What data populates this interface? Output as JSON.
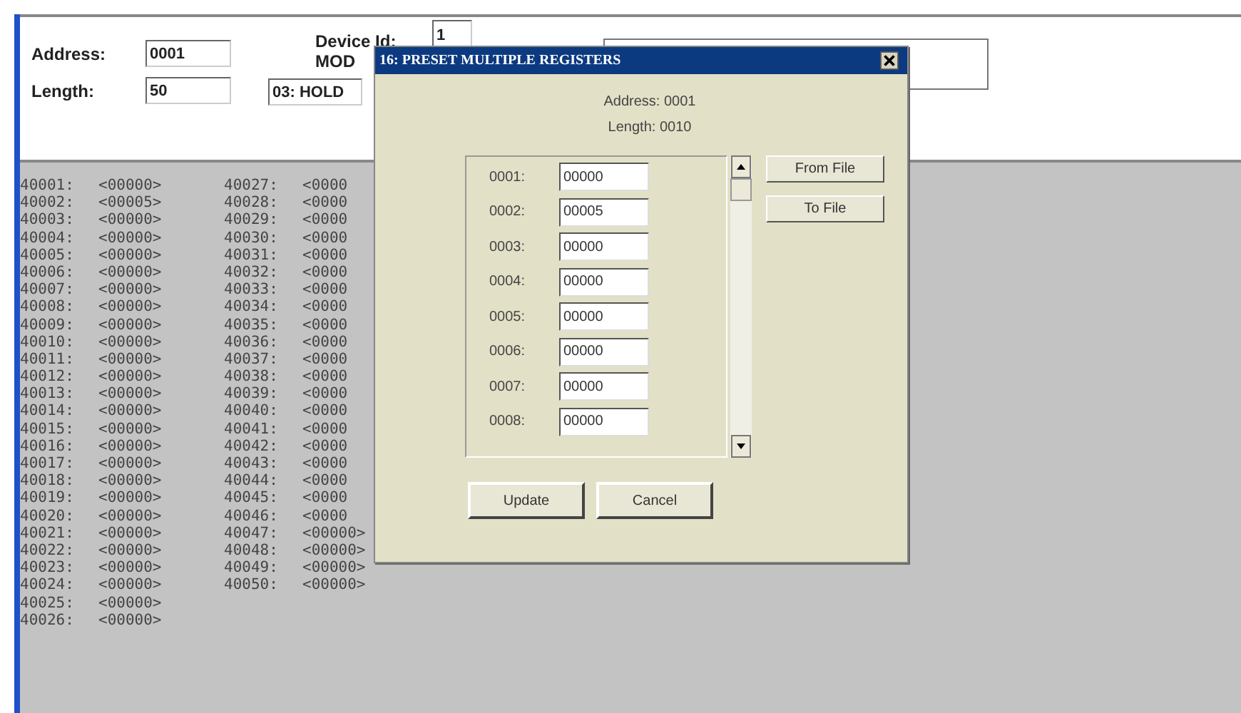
{
  "form": {
    "address_label": "Address:",
    "address_value": "0001",
    "length_label": "Length:",
    "length_value": "50",
    "device_id_label": "Device Id:",
    "device_id_value": "1",
    "mode_label": "MOD",
    "function_value": "03: HOLD"
  },
  "registers": {
    "column_1": [
      {
        "address": "40001:",
        "value": "<00000>"
      },
      {
        "address": "40002:",
        "value": "<00005>"
      },
      {
        "address": "40003:",
        "value": "<00000>"
      },
      {
        "address": "40004:",
        "value": "<00000>"
      },
      {
        "address": "40005:",
        "value": "<00000>"
      },
      {
        "address": "40006:",
        "value": "<00000>"
      },
      {
        "address": "40007:",
        "value": "<00000>"
      },
      {
        "address": "40008:",
        "value": "<00000>"
      },
      {
        "address": "40009:",
        "value": "<00000>"
      },
      {
        "address": "40010:",
        "value": "<00000>"
      },
      {
        "address": "40011:",
        "value": "<00000>"
      },
      {
        "address": "40012:",
        "value": "<00000>"
      },
      {
        "address": "40013:",
        "value": "<00000>"
      },
      {
        "address": "40014:",
        "value": "<00000>"
      },
      {
        "address": "40015:",
        "value": "<00000>"
      },
      {
        "address": "40016:",
        "value": "<00000>"
      },
      {
        "address": "40017:",
        "value": "<00000>"
      },
      {
        "address": "40018:",
        "value": "<00000>"
      },
      {
        "address": "40019:",
        "value": "<00000>"
      },
      {
        "address": "40020:",
        "value": "<00000>"
      },
      {
        "address": "40021:",
        "value": "<00000>"
      },
      {
        "address": "40022:",
        "value": "<00000>"
      },
      {
        "address": "40023:",
        "value": "<00000>"
      },
      {
        "address": "40024:",
        "value": "<00000>"
      },
      {
        "address": "40025:",
        "value": "<00000>"
      },
      {
        "address": "40026:",
        "value": "<00000>"
      }
    ],
    "column_2": [
      {
        "address": "40027:",
        "value": "<0000"
      },
      {
        "address": "40028:",
        "value": "<0000"
      },
      {
        "address": "40029:",
        "value": "<0000"
      },
      {
        "address": "40030:",
        "value": "<0000"
      },
      {
        "address": "40031:",
        "value": "<0000"
      },
      {
        "address": "40032:",
        "value": "<0000"
      },
      {
        "address": "40033:",
        "value": "<0000"
      },
      {
        "address": "40034:",
        "value": "<0000"
      },
      {
        "address": "40035:",
        "value": "<0000"
      },
      {
        "address": "40036:",
        "value": "<0000"
      },
      {
        "address": "40037:",
        "value": "<0000"
      },
      {
        "address": "40038:",
        "value": "<0000"
      },
      {
        "address": "40039:",
        "value": "<0000"
      },
      {
        "address": "40040:",
        "value": "<0000"
      },
      {
        "address": "40041:",
        "value": "<0000"
      },
      {
        "address": "40042:",
        "value": "<0000"
      },
      {
        "address": "40043:",
        "value": "<0000"
      },
      {
        "address": "40044:",
        "value": "<0000"
      },
      {
        "address": "40045:",
        "value": "<0000"
      },
      {
        "address": "40046:",
        "value": "<0000"
      },
      {
        "address": "40047:",
        "value": "<00000>"
      },
      {
        "address": "40048:",
        "value": "<00000>"
      },
      {
        "address": "40049:",
        "value": "<00000>"
      },
      {
        "address": "40050:",
        "value": "<00000>"
      }
    ]
  },
  "dialog": {
    "title": "16: PRESET MULTIPLE REGISTERS",
    "address_text": "Address: 0001",
    "length_text": "Length: 0010",
    "rows": [
      {
        "label": "0001:",
        "value": "00000"
      },
      {
        "label": "0002:",
        "value": "00005"
      },
      {
        "label": "0003:",
        "value": "00000"
      },
      {
        "label": "0004:",
        "value": "00000"
      },
      {
        "label": "0005:",
        "value": "00000"
      },
      {
        "label": "0006:",
        "value": "00000"
      },
      {
        "label": "0007:",
        "value": "00000"
      },
      {
        "label": "0008:",
        "value": "00000"
      }
    ],
    "side_buttons": [
      "From File",
      "To File"
    ],
    "buttons": [
      "Update",
      "Cancel"
    ]
  }
}
